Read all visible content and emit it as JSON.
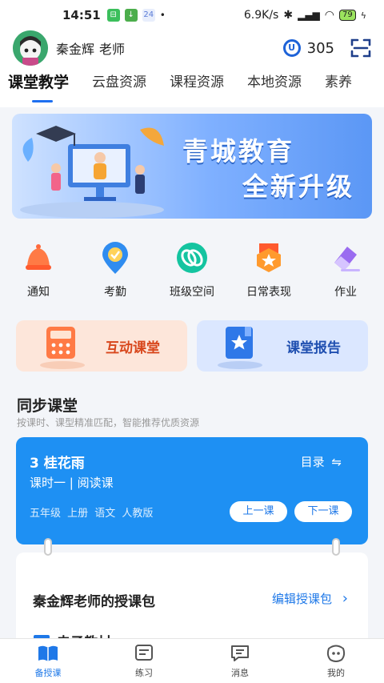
{
  "status_bar": {
    "time": "14:51",
    "network_speed": "6.9K/s",
    "battery": "79"
  },
  "header": {
    "user_name": "秦金辉",
    "user_role": "老师",
    "coins": "305"
  },
  "tabs": [
    {
      "label": "课堂教学",
      "active": true
    },
    {
      "label": "云盘资源",
      "active": false
    },
    {
      "label": "课程资源",
      "active": false
    },
    {
      "label": "本地资源",
      "active": false
    },
    {
      "label": "素养",
      "active": false
    }
  ],
  "banner": {
    "line1": "青城教育",
    "line2": "全新升级"
  },
  "quick_actions": [
    {
      "label": "通知",
      "icon": "bell-icon",
      "color": "#ff6a3d"
    },
    {
      "label": "考勤",
      "icon": "location-check-icon",
      "color": "#2f8cf0"
    },
    {
      "label": "班级空间",
      "icon": "link-ring-icon",
      "color": "#14c4a0"
    },
    {
      "label": "日常表现",
      "icon": "medal-icon",
      "color": "#ff9a2e"
    },
    {
      "label": "作业",
      "icon": "pencil-eraser-icon",
      "color": "#9a6cf0"
    }
  ],
  "feature_cards": {
    "interactive": {
      "label": "互动课堂",
      "color": "#d8471c",
      "bg": "#fde6da"
    },
    "report": {
      "label": "课堂报告",
      "color": "#1f4fb0",
      "bg": "#dbe7ff"
    }
  },
  "sync_section": {
    "title": "同步课堂",
    "subtitle": "按课时、课型精准匹配，智能推荐优质资源"
  },
  "lesson_card": {
    "title": "3 桂花雨",
    "subtitle": "课时一 | 阅读课",
    "meta": "五年级 上册 语文 人教版",
    "toc_label": "目录",
    "prev_label": "上一课",
    "next_label": "下一课"
  },
  "package_card": {
    "title": "秦金辉老师的授课包",
    "edit_label": "编辑授课包",
    "ebook_label": "电子教材"
  },
  "bottom_nav": [
    {
      "label": "备授课",
      "icon": "book-icon",
      "active": true
    },
    {
      "label": "练习",
      "icon": "practice-icon",
      "active": false
    },
    {
      "label": "消息",
      "icon": "message-icon",
      "active": false
    },
    {
      "label": "我的",
      "icon": "profile-face-icon",
      "active": false
    }
  ]
}
